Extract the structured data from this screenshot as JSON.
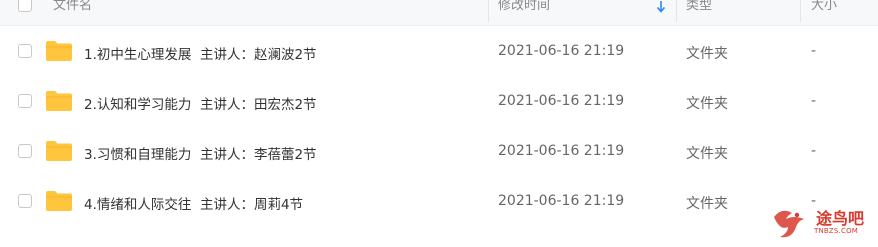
{
  "header": {
    "name_label": "文件名",
    "modified_label": "修改时间",
    "type_label": "类型",
    "size_label": "大小",
    "sort_icon": "arrow-down-icon",
    "accent_color": "#2b87ff"
  },
  "rows": [
    {
      "name": "1.初中生心理发展  主讲人：赵澜波2节",
      "modified": "2021-06-16 21:19",
      "type": "文件夹",
      "size": "-"
    },
    {
      "name": "2.认知和学习能力  主讲人：田宏杰2节",
      "modified": "2021-06-16 21:19",
      "type": "文件夹",
      "size": "-"
    },
    {
      "name": "3.习惯和自理能力  主讲人：李蓓蕾2节",
      "modified": "2021-06-16 21:19",
      "type": "文件夹",
      "size": "-"
    },
    {
      "name": "4.情绪和人际交往  主讲人：周莉4节",
      "modified": "2021-06-16 21:19",
      "type": "文件夹",
      "size": "-"
    }
  ],
  "folder_icon": "folder-icon",
  "folder_color": "#ffc53d",
  "watermark": {
    "text": "途鸟吧",
    "sub": "TNBZS.COM"
  }
}
